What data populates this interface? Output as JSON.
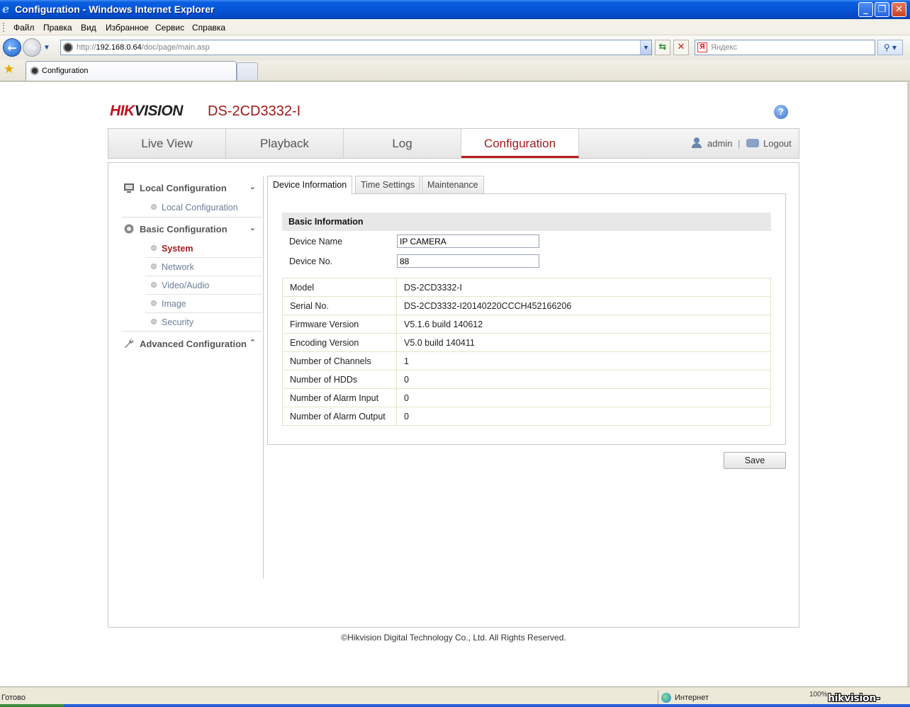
{
  "window": {
    "title": "Configuration - Windows Internet Explorer",
    "menu": [
      "Файл",
      "Правка",
      "Вид",
      "Избранное",
      "Сервис",
      "Справка"
    ],
    "url_prefix": "http://",
    "url_host": "192.168.0.64",
    "url_path": "/doc/page/main.asp",
    "search_placeholder": "Яндекс",
    "tab_title": "Configuration",
    "status_text": "Готово",
    "zone_text": "Интернет",
    "zoom_text": "100%",
    "watermark": "hikvision-msk.ru"
  },
  "page": {
    "brand": "HIKVISION",
    "model": "DS-2CD3332-I",
    "nav": [
      "Live View",
      "Playback",
      "Log",
      "Configuration"
    ],
    "active_nav": "Configuration",
    "user": "admin",
    "separator": "|",
    "logout": "Logout",
    "sidebar": {
      "local_header": "Local Configuration",
      "local_items": [
        "Local Configuration"
      ],
      "basic_header": "Basic Configuration",
      "basic_items": [
        "System",
        "Network",
        "Video/Audio",
        "Image",
        "Security"
      ],
      "active_item": "System",
      "advanced_header": "Advanced Configuration"
    },
    "tabs": [
      "Device Information",
      "Time Settings",
      "Maintenance"
    ],
    "active_tab": "Device Information",
    "section_title": "Basic Information",
    "fields": [
      {
        "label": "Device Name",
        "value": "IP CAMERA"
      },
      {
        "label": "Device No.",
        "value": "88"
      }
    ],
    "info_rows": [
      {
        "label": "Model",
        "value": "DS-2CD3332-I"
      },
      {
        "label": "Serial No.",
        "value": "DS-2CD3332-I20140220CCCH452166206"
      },
      {
        "label": "Firmware Version",
        "value": "V5.1.6 build 140612"
      },
      {
        "label": "Encoding Version",
        "value": "V5.0 build 140411"
      },
      {
        "label": "Number of Channels",
        "value": "1"
      },
      {
        "label": "Number of HDDs",
        "value": "0"
      },
      {
        "label": "Number of Alarm Input",
        "value": "0"
      },
      {
        "label": "Number of Alarm Output",
        "value": "0"
      }
    ],
    "save_label": "Save",
    "footer": "©Hikvision Digital Technology Co., Ltd. All Rights Reserved."
  },
  "colors": {
    "brand_red": "#c3111d",
    "active_red": "#a21b1b",
    "xp_blue": "#0555d8"
  }
}
